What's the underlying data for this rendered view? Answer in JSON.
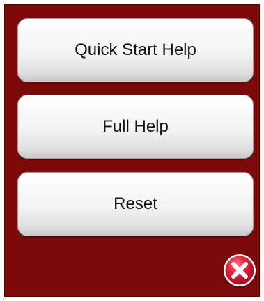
{
  "menu": {
    "quick_start_help": "Quick Start Help",
    "full_help": "Full Help",
    "reset": "Reset"
  },
  "close": {
    "icon": "close-icon"
  },
  "colors": {
    "panel_background": "#7d0a0a",
    "button_face": "#f3f3f3",
    "close_red": "#e0203a"
  }
}
